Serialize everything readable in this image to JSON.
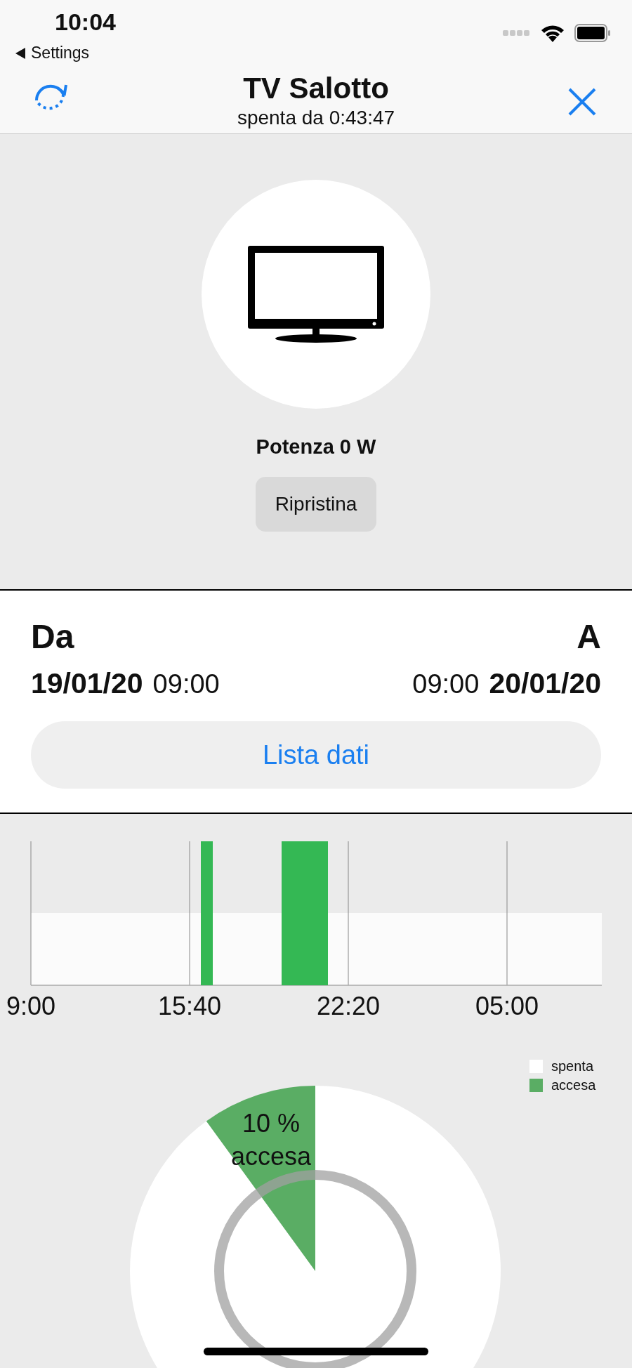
{
  "status_bar": {
    "time": "10:04",
    "back_label": "Settings"
  },
  "nav": {
    "title": "TV Salotto",
    "subtitle": "spenta da 0:43:47"
  },
  "device": {
    "power": "Potenza 0 W",
    "reset_button": "Ripristina"
  },
  "range": {
    "from_label": "Da",
    "to_label": "A",
    "from_date": "19/01/20",
    "from_time": "09:00",
    "to_time": "09:00",
    "to_date": "20/01/20",
    "list_button": "Lista dati"
  },
  "timeline": {
    "tick_labels": [
      "9:00",
      "15:40",
      "22:20",
      "05:00"
    ]
  },
  "share": {
    "chart_data": {
      "type": "pie",
      "categories": [
        "spenta",
        "accesa"
      ],
      "values": [
        90,
        10
      ],
      "colors": [
        "#ffffff",
        "#5aad64"
      ]
    },
    "slice_label": [
      "10 %",
      "accesa"
    ]
  }
}
